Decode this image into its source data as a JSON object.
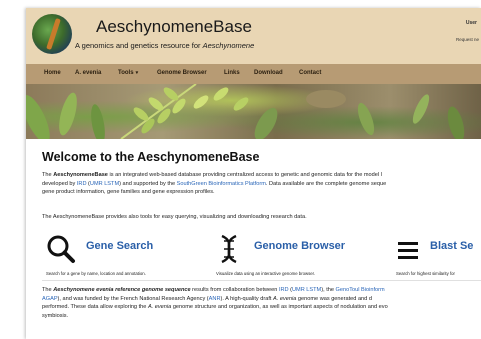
{
  "header": {
    "title": "AeschynomeneBase",
    "subtitle_prefix": "A genomics and genetics resource for ",
    "subtitle_genus": "Aeschynomene",
    "user_label": "User",
    "request_link": "Request ne"
  },
  "nav": {
    "items": [
      "Home",
      "A. evenia",
      "Tools",
      "Genome Browser",
      "Links",
      "Download",
      "Contact"
    ]
  },
  "main": {
    "heading": "Welcome to the AeschynomeneBase",
    "para1": {
      "t1": "The ",
      "bold1": "AeschynomeneBase",
      "t2": " is an integrated web-based database providing centralized access to genetic and genomic data for the model l",
      "t3": "developed by ",
      "ird": "IRD",
      "t4": " (",
      "umr": "UMR LSTM",
      "t5": ") and supported by the ",
      "sgp": "SouthGreen Bioinformatics Platform",
      "t6": ". Data available are the complete genome seque",
      "t7": "gene product information, gene families and gene expression profiles."
    },
    "para2": "The AeschynomeneBase provides also tools for easy querying, visualizing and downloading research data.",
    "tools": [
      {
        "title": "Gene Search",
        "desc": "Search for a gene by name, location and annotation.",
        "icon": "search-icon"
      },
      {
        "title": "Genome Browser",
        "desc": "Visualize data using an interactive genome browser.",
        "icon": "dna-icon"
      },
      {
        "title": "Blast Se",
        "desc": "Search for highest similarity for",
        "icon": "menu-lines-icon"
      }
    ],
    "para3": {
      "t1": "The ",
      "bold1": "Aeschynomene evenia reference genome sequence",
      "t2": " results from collaboration between ",
      "ird": "IRD",
      "t3": " (",
      "umr": "UMR LSTM",
      "t4": "), the ",
      "genotoul": "GenoToul Bioinform",
      "agap": "AGAP",
      "t5": "), and was funded by the French National Research Agency (",
      "anr": "ANR",
      "t6": "). A high-quality draft ",
      "italic1": "A. evenia",
      "t7": " genome was generated and d",
      "t8": "performed. These data allow exploring the ",
      "italic2": "A. evenia",
      "t9": " genome structure and organization, as well as important aspects of nodulation and evo",
      "t10": "symbiosis."
    }
  },
  "colors": {
    "header_bg": "#e9d6b4",
    "nav_bg": "#b79b74",
    "link": "#2a66b8",
    "tool_title": "#2a5fa8"
  }
}
